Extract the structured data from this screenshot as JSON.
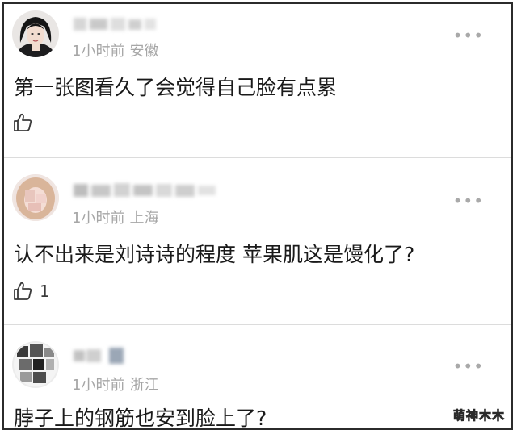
{
  "comments": [
    {
      "time": "1小时前",
      "location": "安徽",
      "text": "第一张图看久了会觉得自己脸有点累",
      "like_count": ""
    },
    {
      "time": "1小时前",
      "location": "上海",
      "text": "认不出来是刘诗诗的程度 苹果肌这是馒化了?",
      "like_count": "1"
    },
    {
      "time": "1小时前",
      "location": "浙江",
      "text": "脖子上的钢筋也安到脸上了?",
      "like_count": ""
    }
  ],
  "more_icon": "•••",
  "icons": {
    "like": "thumbs-up-icon",
    "more": "more-dots-icon"
  },
  "watermark": "萌神木木",
  "colors": {
    "meta_text": "#a6a6a6",
    "body_text": "#1a1a1a",
    "divider": "#dcdcdc"
  }
}
